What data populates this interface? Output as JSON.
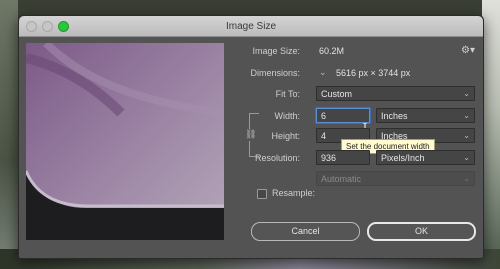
{
  "window": {
    "title": "Image Size"
  },
  "image_size": {
    "label": "Image Size:",
    "value": "60.2M"
  },
  "dimensions": {
    "label": "Dimensions:",
    "value": "5616 px  ×  3744 px"
  },
  "fit_to": {
    "label": "Fit To:",
    "value": "Custom"
  },
  "width": {
    "label": "Width:",
    "value": "6",
    "unit": "Inches"
  },
  "height": {
    "label": "Height:",
    "value": "4",
    "unit": "Inches"
  },
  "resolution": {
    "label": "Resolution:",
    "value": "936",
    "unit": "Pixels/Inch"
  },
  "resample": {
    "label": "Resample:",
    "checked": false,
    "value": "Automatic"
  },
  "tooltip": {
    "text": "Set the document width"
  },
  "buttons": {
    "cancel": "Cancel",
    "ok": "OK"
  },
  "icons": {
    "settings": "gear-icon",
    "link": "chain-link-icon",
    "dimensions_toggle": "chevron-down-icon"
  }
}
